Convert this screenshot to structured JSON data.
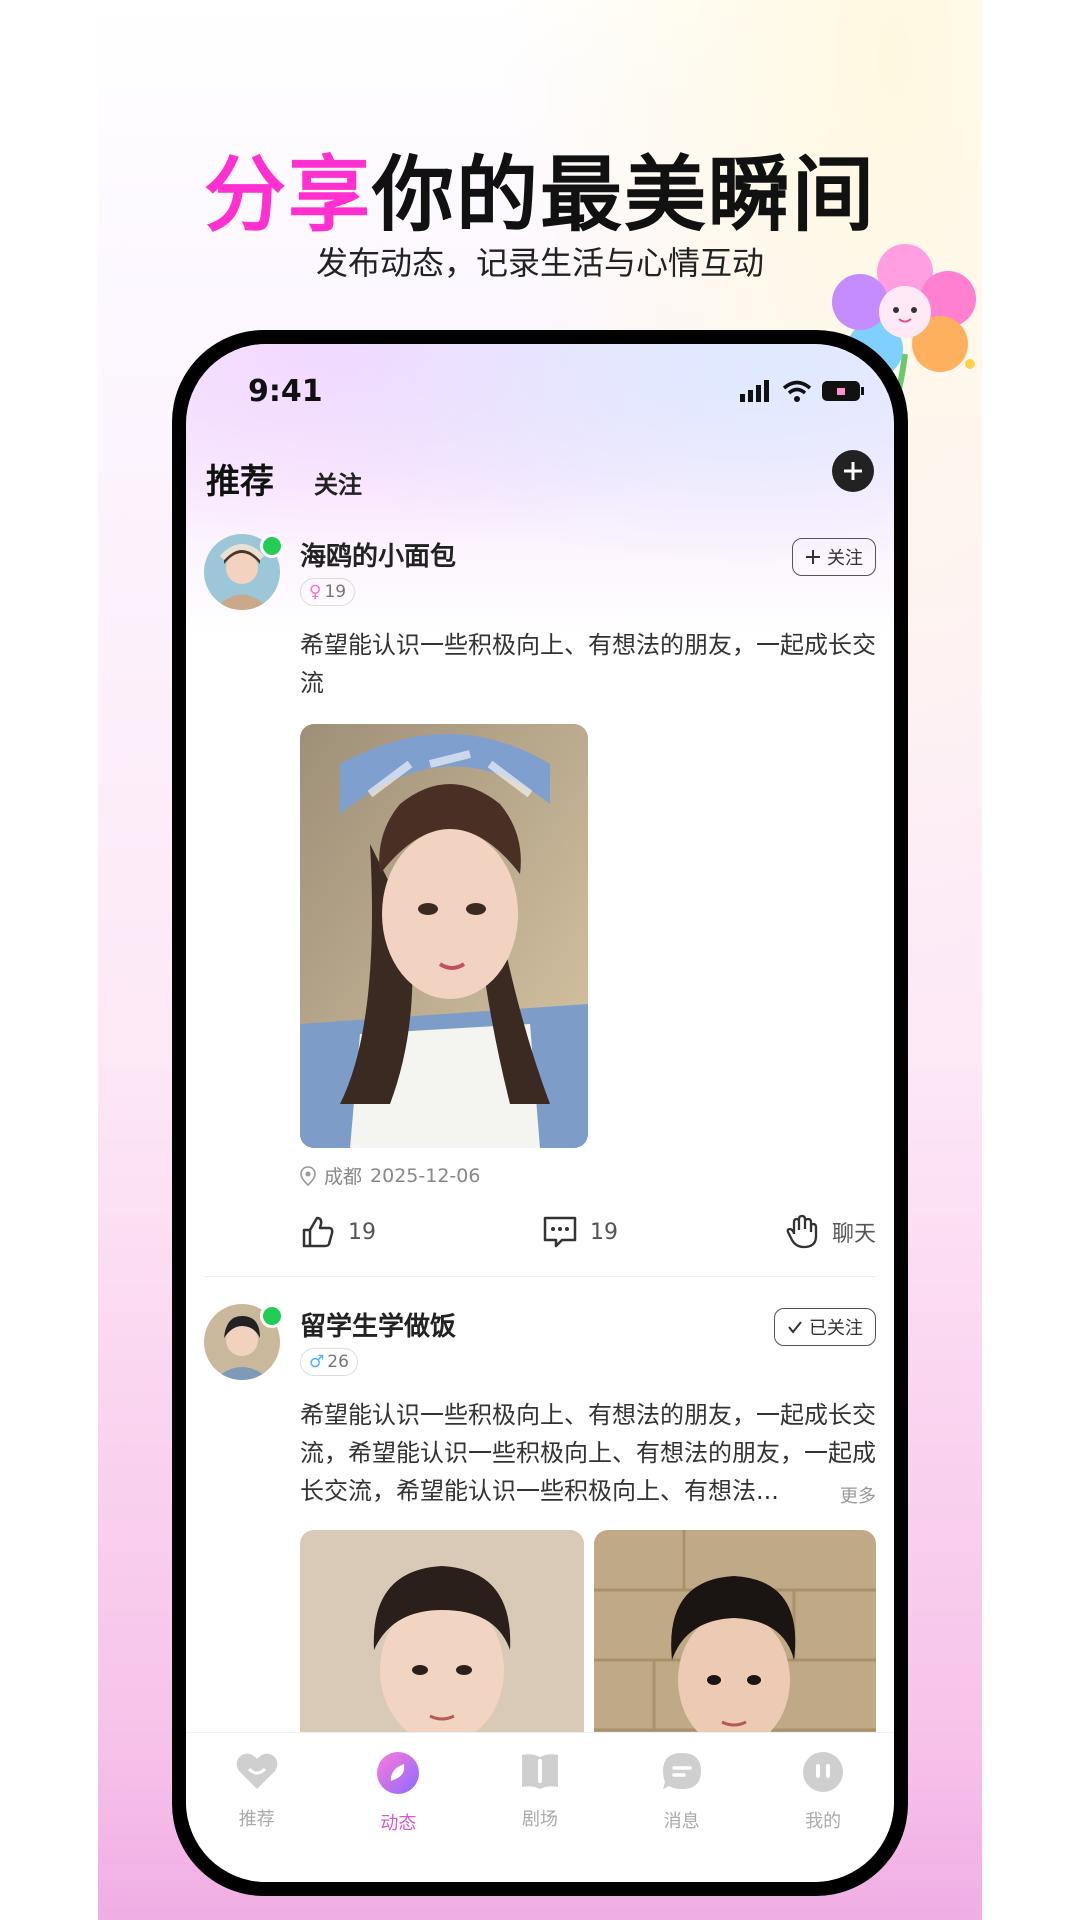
{
  "headline": {
    "highlight": "分享",
    "rest": "你的最美瞬间"
  },
  "subline": "发布动态，记录生活与心情互动",
  "status": {
    "time": "9:41"
  },
  "tabs": {
    "recommend": "推荐",
    "follow": "关注"
  },
  "posts": [
    {
      "name": "海鸥的小面包",
      "gender_symbol": "♀",
      "age": "19",
      "follow_label": "关注",
      "text": "希望能认识一些积极向上、有想法的朋友，一起成长交流",
      "location": "成都",
      "date": "2025-12-06",
      "likes": "19",
      "comments": "19",
      "chat_label": "聊天"
    },
    {
      "name": "留学生学做饭",
      "gender_symbol": "♂",
      "age": "26",
      "follow_label": "已关注",
      "text": "希望能认识一些积极向上、有想法的朋友，一起成长交流，希望能认识一些积极向上、有想法的朋友，一起成长交流，希望能认识一些积极向上、有想法...",
      "more_label": "更多"
    }
  ],
  "tabbar": [
    {
      "label": "推荐",
      "icon": "heart-icon"
    },
    {
      "label": "动态",
      "icon": "feed-icon",
      "active": true
    },
    {
      "label": "剧场",
      "icon": "theater-icon"
    },
    {
      "label": "消息",
      "icon": "message-icon"
    },
    {
      "label": "我的",
      "icon": "profile-icon"
    }
  ],
  "colors": {
    "accent_pink": "#ff2fd0",
    "active_tab": "#d35ad0",
    "online": "#22cc55"
  }
}
